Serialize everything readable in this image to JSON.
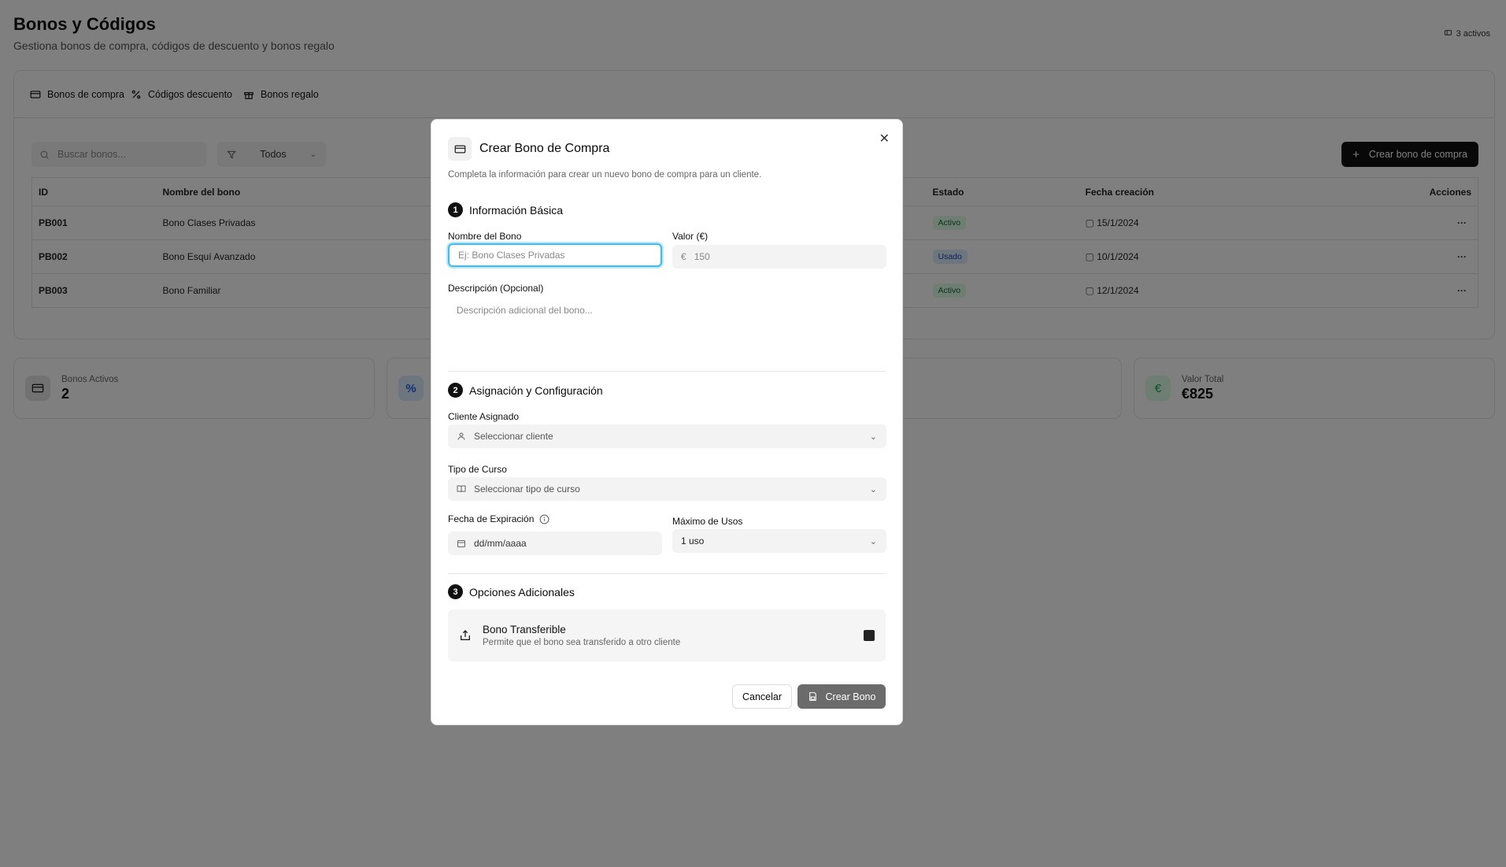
{
  "page": {
    "title": "Bonos y Códigos",
    "subtitle": "Gestiona bonos de compra, códigos de descuento y bonos regalo",
    "active_count": "3 activos"
  },
  "tabs": [
    {
      "label": "Bonos de compra",
      "icon": "credit-card-icon"
    },
    {
      "label": "Códigos descuento",
      "icon": "percent-icon"
    },
    {
      "label": "Bonos regalo",
      "icon": "gift-icon"
    }
  ],
  "toolbar": {
    "search_placeholder": "Buscar bonos...",
    "filter_value": "Todos",
    "create_label": "Crear bono de compra"
  },
  "table": {
    "headers": [
      "ID",
      "Nombre del bono",
      "Estado",
      "Fecha creación",
      "Acciones"
    ],
    "rows": [
      {
        "id": "PB001",
        "name": "Bono Clases Privadas",
        "status": "Activo",
        "date": "15/1/2024"
      },
      {
        "id": "PB002",
        "name": "Bono Esquí Avanzado",
        "status": "Usado",
        "date": "10/1/2024"
      },
      {
        "id": "PB003",
        "name": "Bono Familiar",
        "status": "Activo",
        "date": "12/1/2024"
      }
    ]
  },
  "stats": [
    {
      "label": "Bonos Activos",
      "value": "2"
    },
    {
      "label": "Valor Total",
      "value": "€825"
    }
  ],
  "modal": {
    "title": "Crear Bono de Compra",
    "description": "Completa la información para crear un nuevo bono de compra para un cliente.",
    "section1": {
      "num": "1",
      "title": "Información Básica"
    },
    "name_label": "Nombre del Bono",
    "name_placeholder": "Ej: Bono Clases Privadas",
    "value_label": "Valor (€)",
    "value_symbol": "€",
    "value_placeholder": "150",
    "desc_label": "Descripción (Opcional)",
    "desc_placeholder": "Descripción adicional del bono...",
    "section2": {
      "num": "2",
      "title": "Asignación y Configuración"
    },
    "client_label": "Cliente Asignado",
    "client_placeholder": "Seleccionar cliente",
    "course_label": "Tipo de Curso",
    "course_placeholder": "Seleccionar tipo de curso",
    "expiry_label": "Fecha de Expiración",
    "expiry_placeholder": "dd/mm/aaaa",
    "max_uses_label": "Máximo de Usos",
    "max_uses_value": "1 uso",
    "section3": {
      "num": "3",
      "title": "Opciones Adicionales"
    },
    "transfer_title": "Bono Transferible",
    "transfer_desc": "Permite que el bono sea transferido a otro cliente",
    "cancel_label": "Cancelar",
    "create_label": "Crear Bono"
  }
}
